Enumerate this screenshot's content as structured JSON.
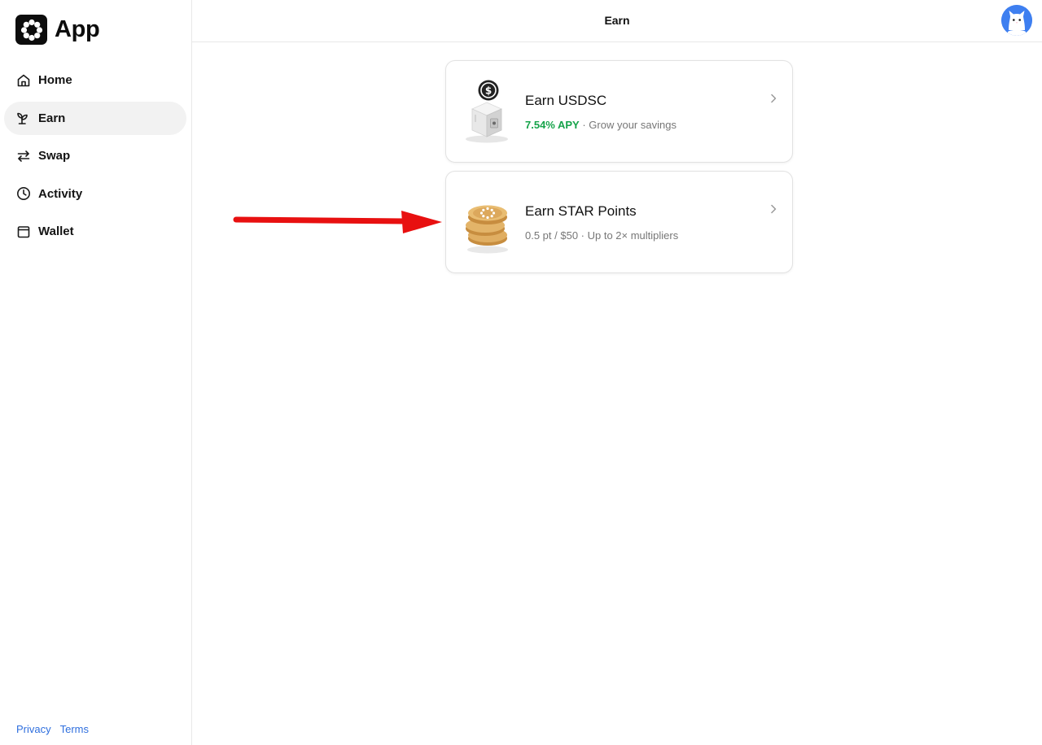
{
  "brand": {
    "name": "App",
    "icon": "app-logo-icon"
  },
  "nav": {
    "items": [
      {
        "label": "Home",
        "icon": "home-icon",
        "active": false
      },
      {
        "label": "Earn",
        "icon": "sprout-icon",
        "active": true
      },
      {
        "label": "Swap",
        "icon": "swap-arrows-icon",
        "active": false
      },
      {
        "label": "Activity",
        "icon": "clock-icon",
        "active": false
      },
      {
        "label": "Wallet",
        "icon": "wallet-icon",
        "active": false
      }
    ]
  },
  "footer": {
    "privacy": "Privacy",
    "terms": "Terms"
  },
  "header": {
    "title": "Earn",
    "avatar_icon": "cat-avatar-icon"
  },
  "cards": [
    {
      "title": "Earn USDSC",
      "apy": "7.54% APY",
      "separator": " · ",
      "subtitle": "Grow your savings",
      "icon": "safe-with-dollar-coin-icon"
    },
    {
      "title": "Earn STAR Points",
      "subtitle": "0.5 pt / $50 · Up to 2× multipliers",
      "icon": "coin-stack-icon"
    }
  ],
  "colors": {
    "accent_green": "#16a34a",
    "link_blue": "#2f6fde",
    "active_nav_bg": "#f2f2f2",
    "avatar_bg": "#3e7ff0",
    "annotation_arrow": "#e81010"
  }
}
